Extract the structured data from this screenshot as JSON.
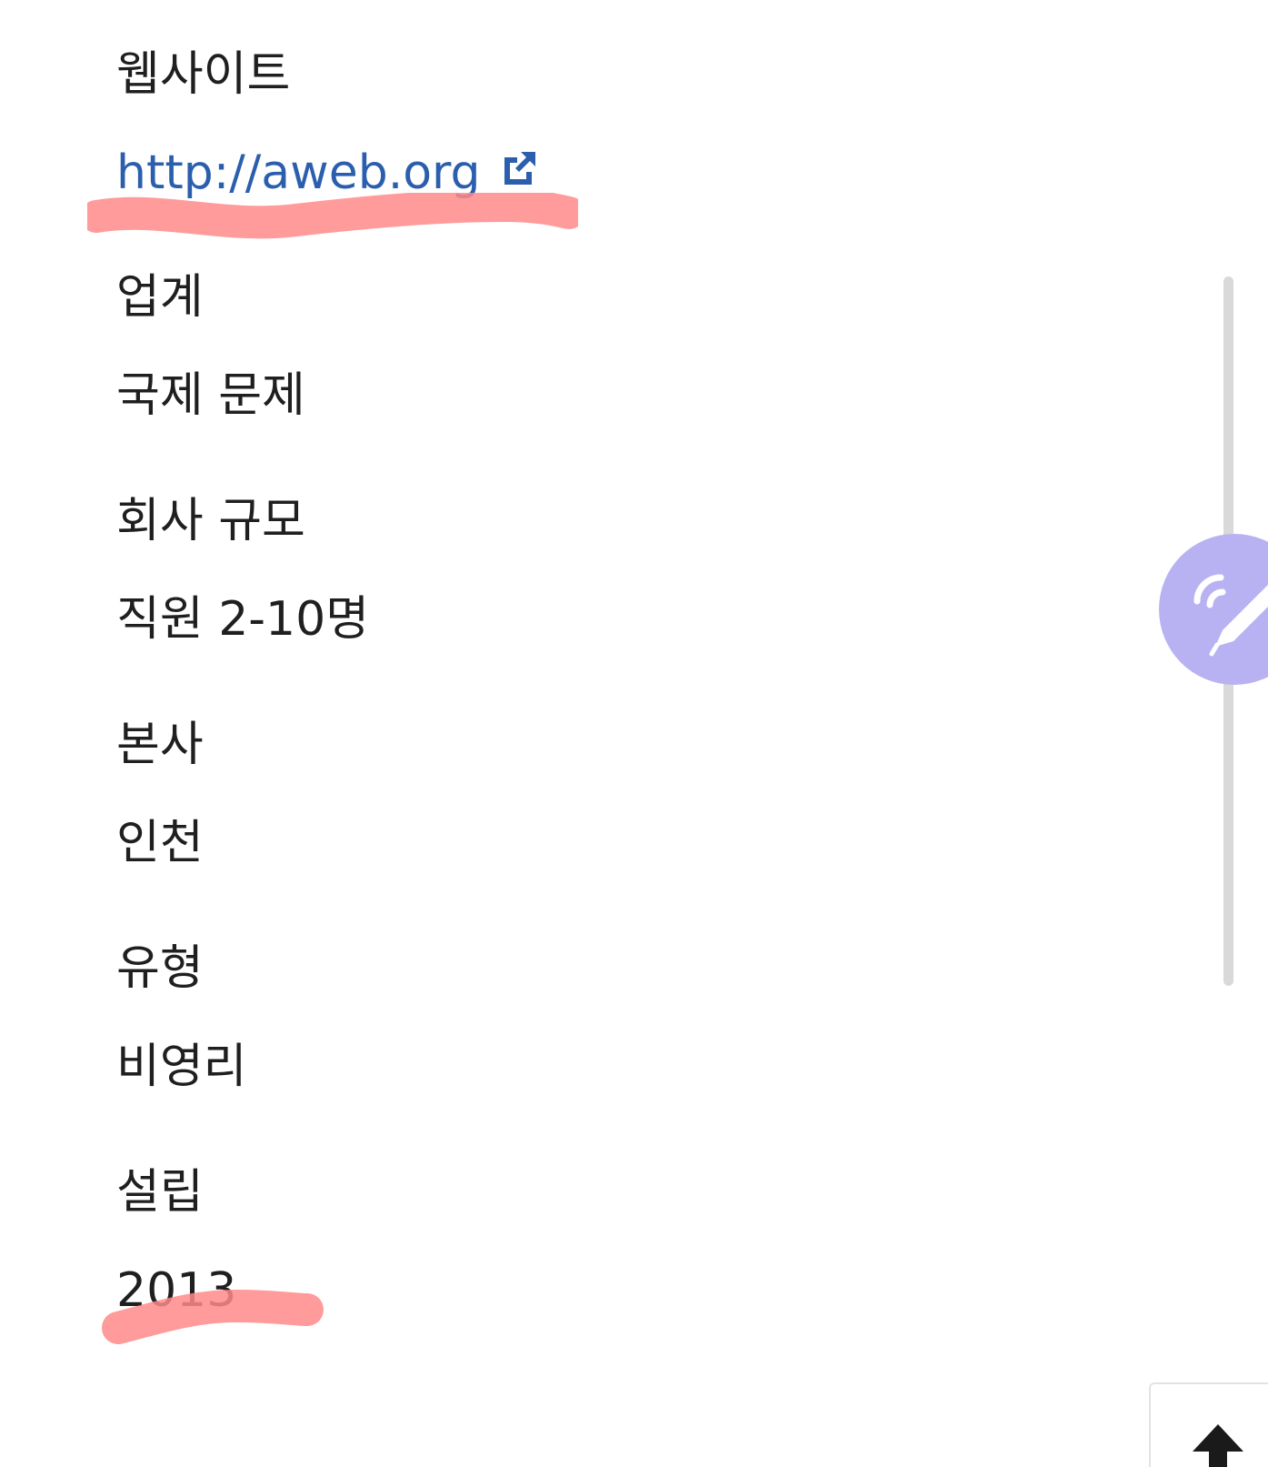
{
  "company": {
    "website_label": "웹사이트",
    "website_url": "http://aweb.org",
    "industry_label": "업계",
    "industry_value": "국제 문제",
    "size_label": "회사 규모",
    "size_value": "직원 2-10명",
    "hq_label": "본사",
    "hq_value": "인천",
    "type_label": "유형",
    "type_value": "비영리",
    "founded_label": "설립",
    "founded_value": "2013"
  },
  "icons": {
    "external_link": "external-link-icon",
    "floating_action": "pen-signal-icon",
    "back_to_top": "arrow-up-icon"
  },
  "colors": {
    "link": "#2b5fad",
    "marker": "#ff8a8a",
    "fab": "#b8b2f2",
    "scrollbar": "#d9d9d9"
  }
}
